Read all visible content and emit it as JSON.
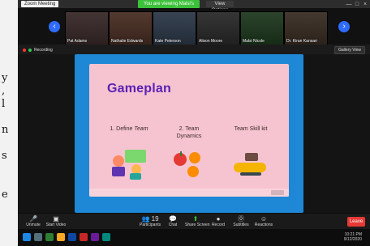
{
  "window": {
    "title": "Zoom Meeting",
    "share_banner": "You are viewing Malsi's screen",
    "view_options": "View Options",
    "controls": [
      "—",
      "□",
      "×"
    ]
  },
  "participants": {
    "tiles": [
      {
        "name": "Pat Adams"
      },
      {
        "name": "Nathalie Edwards"
      },
      {
        "name": "Kate Peterson"
      },
      {
        "name": "Alison Moore"
      },
      {
        "name": "Malsi Nicole"
      },
      {
        "name": "Dr. Kiran Kansari"
      }
    ]
  },
  "main_header": {
    "recording_label": "Recording",
    "view_button": "Gallery View"
  },
  "slide": {
    "title": "Gameplan",
    "columns": [
      {
        "line1": "1. Define ",
        "emph": "Team",
        "line2": ""
      },
      {
        "line1": "2. Team",
        "emph": "",
        "line2": "Dynamics"
      },
      {
        "line1": "Team Skill kit",
        "emph": "",
        "line2": ""
      }
    ]
  },
  "toolbar": {
    "buttons": [
      {
        "icon": "microphone-icon",
        "label": "Unmute"
      },
      {
        "icon": "video-icon",
        "label": "Start Video"
      },
      {
        "icon": "participants-icon",
        "label": "Participants"
      },
      {
        "icon": "chat-icon",
        "label": "Chat"
      },
      {
        "icon": "share-icon",
        "label": "Share Screen"
      },
      {
        "icon": "record-icon",
        "label": "Record"
      },
      {
        "icon": "captions-icon",
        "label": "Subtitles"
      },
      {
        "icon": "reactions-icon",
        "label": "Reactions"
      }
    ],
    "participants_count": "19",
    "end_label": "Leave"
  },
  "taskbar": {
    "time": "10:21 PM",
    "date": "9/12/2020"
  },
  "side_text": {
    "lines": [
      "y",
      ",",
      "l",
      "n",
      "s",
      "e"
    ]
  },
  "colors": {
    "share_banner": "#3cc13b",
    "shared_bg": "#1e88d6",
    "slide_bg": "#f6c4d0",
    "slide_title": "#5a21b5",
    "end_button": "#e53935",
    "nav_button": "#2f6bff"
  }
}
